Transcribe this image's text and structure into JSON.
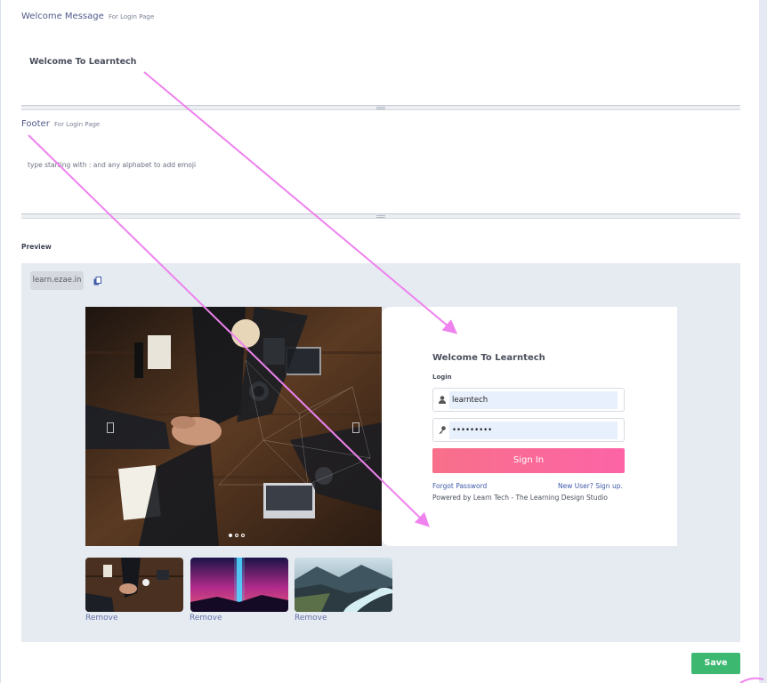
{
  "welcome": {
    "title": "Welcome Message",
    "subtitle": "For Login Page",
    "content": "Welcome To Learntech"
  },
  "footer": {
    "title": "Footer",
    "subtitle": "For Login Page",
    "placeholder": "type starting with : and any alphabet to add emoji"
  },
  "preview": {
    "label": "Preview",
    "url": "learn.ezae.in",
    "login": {
      "title": "Welcome To Learntech",
      "label": "Login",
      "username": "learntech",
      "password": "•••••••••",
      "signin_label": "Sign In",
      "forgot_label": "Forgot Password",
      "signup_label": "New User? Sign up.",
      "powered_by": "Powered by Learn Tech - The Learning Design Studio"
    },
    "carousel": {
      "slides": 3,
      "active": 1
    },
    "thumbnails": [
      {
        "name": "team-hands",
        "remove_label": "Remove"
      },
      {
        "name": "neon-light",
        "remove_label": "Remove"
      },
      {
        "name": "mountain-river",
        "remove_label": "Remove"
      }
    ]
  },
  "actions": {
    "save_label": "Save"
  },
  "colors": {
    "accent": "#f8708a",
    "save": "#3cb870",
    "annotation": "#ee82ee"
  }
}
